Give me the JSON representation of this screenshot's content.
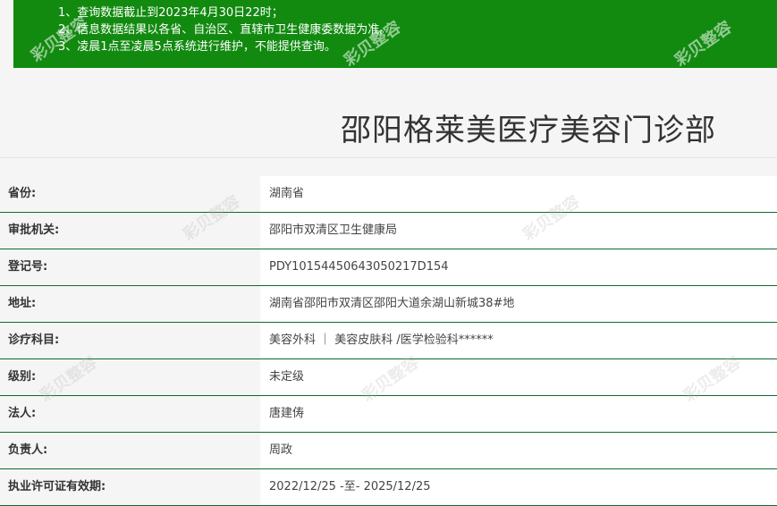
{
  "notice": {
    "lines": [
      "1、查询数据截止到2023年4月30日22时；",
      "2、信息数据结果以各省、自治区、直辖市卫生健康委数据为准。",
      "3、凌晨1点至凌晨5点系统进行维护，不能提供查询。"
    ]
  },
  "org_name": "邵阳格莱美医疗美容门诊部",
  "rows": [
    {
      "label": "省份:",
      "value": "湖南省"
    },
    {
      "label": "审批机关:",
      "value": "邵阳市双清区卫生健康局"
    },
    {
      "label": "登记号:",
      "value": "PDY10154450643050217D154"
    },
    {
      "label": "地址:",
      "value": "湖南省邵阳市双清区邵阳大道余湖山新城38#地"
    },
    {
      "label": "诊疗科目:",
      "value": "美容外科 ｜ 美容皮肤科 /医学检验科******"
    },
    {
      "label": "级别:",
      "value": "未定级"
    },
    {
      "label": "法人:",
      "value": "唐建俦"
    },
    {
      "label": "负责人:",
      "value": "周政"
    },
    {
      "label": "执业许可证有效期:",
      "value": "2022/12/25 -至- 2025/12/25"
    }
  ],
  "watermark": "彩贝整容",
  "colors": {
    "notice_bg": "#118a0f",
    "row_border": "#0f6b2e"
  }
}
